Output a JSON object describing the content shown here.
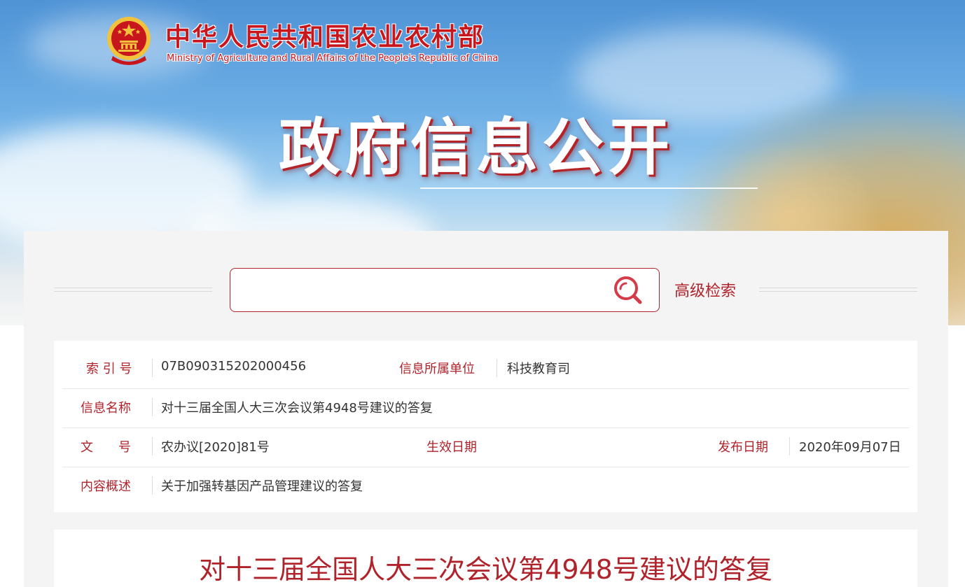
{
  "header": {
    "ministry_cn": "中华人民共和国农业农村部",
    "ministry_en": "Ministry of Agriculture and Rural Affairs of the People's Republic of China",
    "banner_title": "政府信息公开"
  },
  "search": {
    "placeholder": "",
    "value": "",
    "advanced_label": "高级检索"
  },
  "info": {
    "index_label": "索 引 号",
    "index_value": "07B090315202000456",
    "unit_label": "信息所属单位",
    "unit_value": "科技教育司",
    "name_label": "信息名称",
    "name_value": "对十三届全国人大三次会议第4948号建议的答复",
    "doc_no_label": "文　　号",
    "doc_no_value": "农办议[2020]81号",
    "effective_label": "生效日期",
    "effective_value": "",
    "publish_label": "发布日期",
    "publish_value": "2020年09月07日",
    "summary_label": "内容概述",
    "summary_value": "关于加强转基因产品管理建议的答复"
  },
  "document": {
    "title": "对十三届全国人大三次会议第4948号建议的答复"
  },
  "colors": {
    "accent": "#b0232b",
    "emblem_red": "#c8161d",
    "emblem_gold": "#f2c23c"
  }
}
